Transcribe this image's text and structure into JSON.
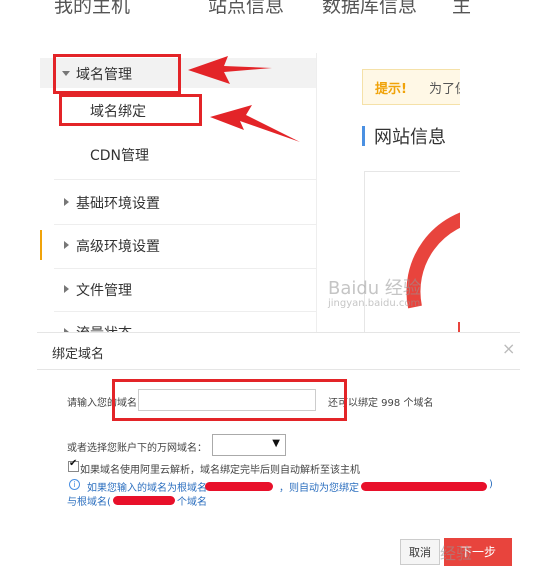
{
  "top_nav": {
    "items": [
      "我的主机",
      "站点信息",
      "数据库信息",
      "主"
    ]
  },
  "sidebar": {
    "items": [
      {
        "label": "域名管理",
        "state": "expanded"
      },
      {
        "label": "域名绑定"
      },
      {
        "label": "CDN管理"
      },
      {
        "label": "基础环境设置",
        "state": "collapsed"
      },
      {
        "label": "高级环境设置",
        "state": "collapsed"
      },
      {
        "label": "文件管理",
        "state": "collapsed"
      },
      {
        "label": "流量状态",
        "state": "collapsed"
      }
    ]
  },
  "right_panel": {
    "notice_label": "提示!",
    "notice_text": "为了保",
    "section_title": "网站信息"
  },
  "dialog": {
    "title": "绑定域名",
    "close_symbol": "×",
    "domain_prompt": "请输入您的域名:",
    "domain_input_value": "",
    "quota_text": "还可以绑定 998 个域名",
    "select_prompt": "或者选择您账户下的万网域名：",
    "select_value": "",
    "checkbox_label": "如果域名使用阿里云解析，域名绑定完毕后则自动解析至该主机",
    "info_line1_a": "如果您输入的域名为根域名",
    "info_line1_b": "，则自动为您绑定",
    "info_line1_c": ")",
    "info_line2_a": "与根域名(",
    "info_line2_b": "个域名",
    "cancel_label": "取消",
    "ok_label": "下一步"
  },
  "watermarks": [
    "Baidu 经验",
    "jingyan.baidu.com",
    "经验"
  ],
  "colors": {
    "annotation": "#e32428",
    "accent": "#e8443d",
    "link": "#2c6fbf",
    "notice_key": "#f0a30a"
  }
}
